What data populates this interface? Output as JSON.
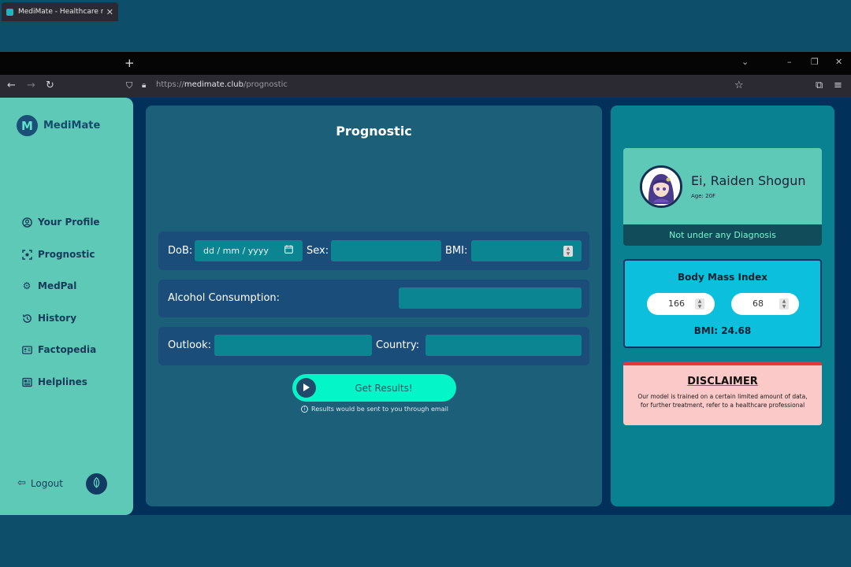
{
  "browser": {
    "tab_title": "MediMate - Healthcare made e",
    "tab_close": "✕",
    "new_tab": "+",
    "url_prefix": "https://",
    "url_host": "medimate.club",
    "url_path": "/prognostic"
  },
  "sidebar": {
    "logo_mark": "M",
    "app_name": "MediMate",
    "items": [
      {
        "label": "Your Profile",
        "icon": "user-circle-icon"
      },
      {
        "label": "Prognostic",
        "icon": "scan-icon"
      },
      {
        "label": "MedPal",
        "icon": "gear-icon"
      },
      {
        "label": "History",
        "icon": "history-icon"
      },
      {
        "label": "Factopedia",
        "icon": "id-card-icon"
      },
      {
        "label": "Helplines",
        "icon": "newspaper-icon"
      }
    ],
    "logout_label": "Logout"
  },
  "main": {
    "title": "Prognostic",
    "dob_label": "DoB:",
    "dob_placeholder": "dd / mm / yyyy",
    "sex_label": "Sex:",
    "bmi_label": "BMI:",
    "alcohol_label": "Alcohol Consumption:",
    "outlook_label": "Outlook:",
    "country_label": "Country:",
    "submit_label": "Get Results!",
    "note": "Results would be sent to you through email"
  },
  "profile": {
    "name": "Ei, Raiden Shogun",
    "age": "Age: 20F",
    "diagnosis": "Not under any Diagnosis"
  },
  "bmi": {
    "title": "Body Mass Index",
    "height": "166",
    "weight": "68",
    "result": "BMI: 24.68"
  },
  "disclaimer": {
    "title": "DISCLAIMER",
    "text": "Our model is trained on a certain limited amount of data, for further treatment, refer to a healthcare professional"
  },
  "colors": {
    "sidebar": "#5ec9b7",
    "main_panel": "#1b5f79",
    "accent_button": "#03f5c8",
    "bmi_card": "#0bbfdd",
    "disclaimer_bg": "#fbc9c7",
    "disclaimer_accent": "#e2383b"
  }
}
